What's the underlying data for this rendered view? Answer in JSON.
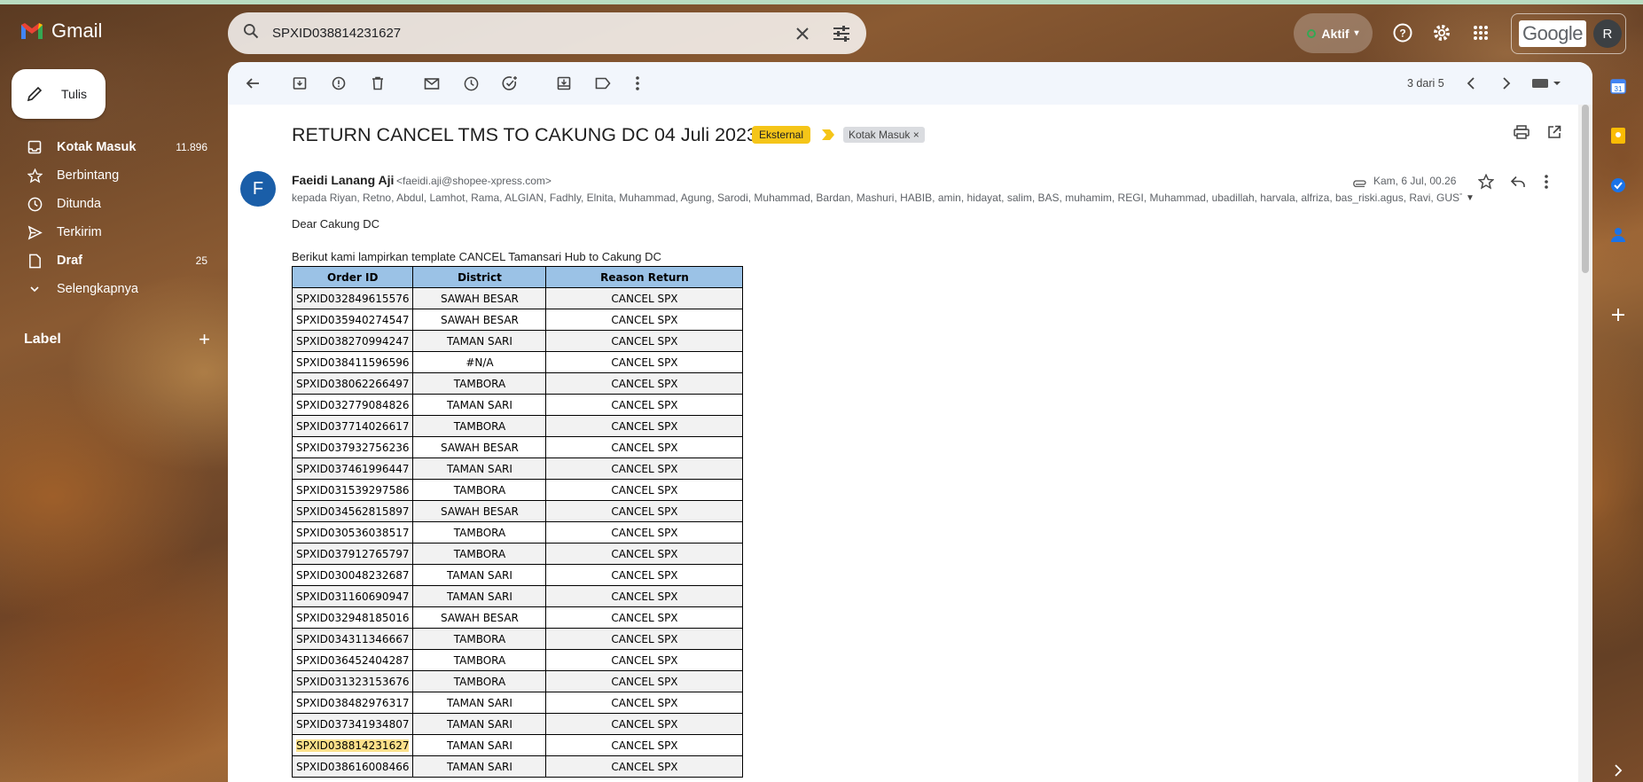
{
  "app": {
    "name": "Gmail"
  },
  "search": {
    "query": "SPXID038814231627"
  },
  "status": {
    "label": "Aktif"
  },
  "account": {
    "brand": "Google",
    "avatar_letter": "R"
  },
  "compose": {
    "label": "Tulis"
  },
  "nav": {
    "items": [
      {
        "label": "Kotak Masuk",
        "count": "11.896",
        "icon": "inbox-icon",
        "bold": true
      },
      {
        "label": "Berbintang",
        "count": "",
        "icon": "star-icon",
        "bold": false
      },
      {
        "label": "Ditunda",
        "count": "",
        "icon": "clock-icon",
        "bold": false
      },
      {
        "label": "Terkirim",
        "count": "",
        "icon": "send-icon",
        "bold": false
      },
      {
        "label": "Draf",
        "count": "25",
        "icon": "draft-icon",
        "bold": true
      },
      {
        "label": "Selengkapnya",
        "count": "",
        "icon": "chevron-down-icon",
        "bold": false
      }
    ],
    "labels_header": "Label"
  },
  "toolbar": {
    "pager": "3 dari 5"
  },
  "email": {
    "subject": "RETURN CANCEL TMS TO CAKUNG DC 04 Juli 2023",
    "external_badge": "Eksternal",
    "folder_tag": "Kotak Masuk",
    "folder_tag_remove": "×",
    "sender_initial": "F",
    "sender_name": "Faeidi Lanang Aji",
    "sender_email": "<faeidi.aji@shopee-xpress.com>",
    "recipients": "kepada Riyan, Retno, Abdul, Lamhot, Rama, ALGIAN, Fadhly, Elnita, Muhammad, Agung, Sarodi, Muhammad, Bardan, Mashuri, HABIB, amin, hidayat, salim, BAS, muhamim, REGI, Muhammad, ubadillah, harvala, alfriza, bas_riski.agus, Ravi, GUSTI,",
    "date": "Kam, 6 Jul, 00.26",
    "greeting": "Dear Cakung DC",
    "intro": "Berikut kami lampirkan template CANCEL Tamansari Hub to Cakung DC",
    "table": {
      "headers": [
        "Order ID",
        "District",
        "Reason Return"
      ],
      "rows": [
        [
          "SPXID032849615576",
          "SAWAH BESAR",
          "CANCEL SPX"
        ],
        [
          "SPXID035940274547",
          "SAWAH BESAR",
          "CANCEL SPX"
        ],
        [
          "SPXID038270994247",
          "TAMAN SARI",
          "CANCEL SPX"
        ],
        [
          "SPXID038411596596",
          "#N/A",
          "CANCEL SPX"
        ],
        [
          "SPXID038062266497",
          "TAMBORA",
          "CANCEL SPX"
        ],
        [
          "SPXID032779084826",
          "TAMAN SARI",
          "CANCEL SPX"
        ],
        [
          "SPXID037714026617",
          "TAMBORA",
          "CANCEL SPX"
        ],
        [
          "SPXID037932756236",
          "SAWAH BESAR",
          "CANCEL SPX"
        ],
        [
          "SPXID037461996447",
          "TAMAN SARI",
          "CANCEL SPX"
        ],
        [
          "SPXID031539297586",
          "TAMBORA",
          "CANCEL SPX"
        ],
        [
          "SPXID034562815897",
          "SAWAH BESAR",
          "CANCEL SPX"
        ],
        [
          "SPXID030536038517",
          "TAMBORA",
          "CANCEL SPX"
        ],
        [
          "SPXID037912765797",
          "TAMBORA",
          "CANCEL SPX"
        ],
        [
          "SPXID030048232687",
          "TAMAN SARI",
          "CANCEL SPX"
        ],
        [
          "SPXID031160690947",
          "TAMAN SARI",
          "CANCEL SPX"
        ],
        [
          "SPXID032948185016",
          "SAWAH BESAR",
          "CANCEL SPX"
        ],
        [
          "SPXID034311346667",
          "TAMBORA",
          "CANCEL SPX"
        ],
        [
          "SPXID036452404287",
          "TAMBORA",
          "CANCEL SPX"
        ],
        [
          "SPXID031323153676",
          "TAMBORA",
          "CANCEL SPX"
        ],
        [
          "SPXID038482976317",
          "TAMAN SARI",
          "CANCEL SPX"
        ],
        [
          "SPXID037341934807",
          "TAMAN SARI",
          "CANCEL SPX"
        ],
        [
          "SPXID038814231627",
          "TAMAN SARI",
          "CANCEL SPX"
        ],
        [
          "SPXID038616008466",
          "TAMAN SARI",
          "CANCEL SPX"
        ]
      ],
      "highlighted_order_id": "SPXID038814231627"
    }
  },
  "colors": {
    "external_badge": "#f5c518",
    "table_header": "#9bc2e6",
    "search_highlight": "#fce08a",
    "sender_avatar": "#1a5ea8"
  }
}
